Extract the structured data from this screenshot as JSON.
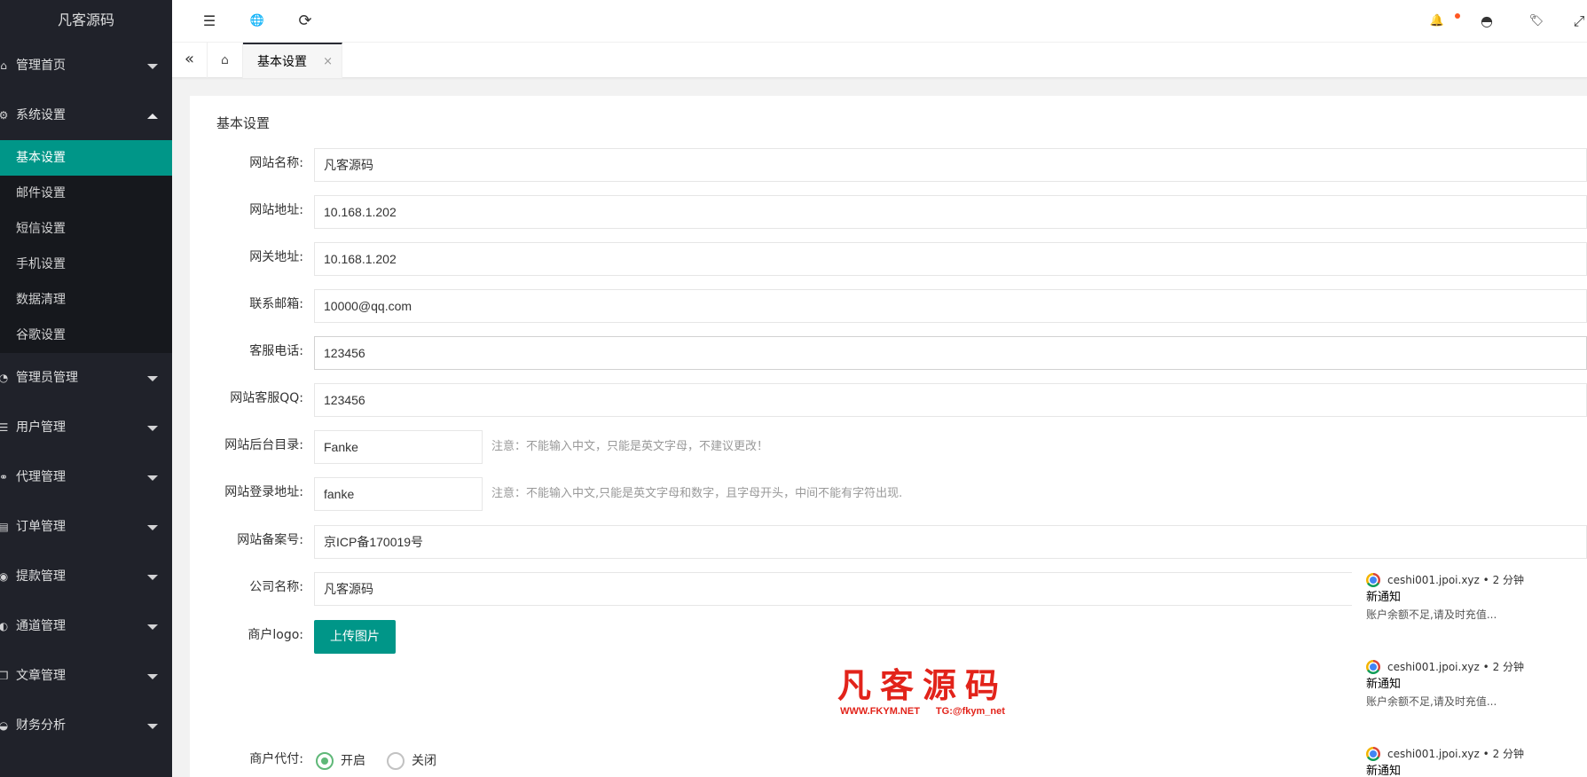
{
  "sidebar": {
    "logo": "凡客源码",
    "menus": [
      {
        "label": "管理首页",
        "icon": "⌂"
      },
      {
        "label": "系统设置",
        "icon": "⚙"
      },
      {
        "label": "管理员管理",
        "icon": "◔"
      },
      {
        "label": "用户管理",
        "icon": "☰"
      },
      {
        "label": "代理管理",
        "icon": "⚭"
      },
      {
        "label": "订单管理",
        "icon": "▤"
      },
      {
        "label": "提款管理",
        "icon": "◉"
      },
      {
        "label": "通道管理",
        "icon": "◐"
      },
      {
        "label": "文章管理",
        "icon": "❐"
      },
      {
        "label": "财务分析",
        "icon": "◒"
      }
    ],
    "submenu": [
      "基本设置",
      "邮件设置",
      "短信设置",
      "手机设置",
      "数据清理",
      "谷歌设置"
    ]
  },
  "header": {
    "icons": {
      "menu": "☰",
      "globe": "🌐",
      "refresh": "⟳",
      "bell": "🔔",
      "theme": "◓",
      "tag": "🏷",
      "expand": "⤢"
    },
    "notify_dot_color": "#ff5722"
  },
  "tabs": {
    "prev": "«",
    "home": "⌂",
    "active_label": "基本设置",
    "close": "×"
  },
  "form": {
    "title": "基本设置",
    "fields": [
      {
        "label": "网站名称:",
        "value": "凡客源码"
      },
      {
        "label": "网站地址:",
        "value": "10.168.1.202"
      },
      {
        "label": "网关地址:",
        "value": "10.168.1.202"
      },
      {
        "label": "联系邮箱:",
        "value": "10000@qq.com"
      },
      {
        "label": "客服电话:",
        "value": "123456"
      },
      {
        "label": "网站客服QQ:",
        "value": "123456"
      },
      {
        "label": "网站后台目录:",
        "value": "Fanke",
        "hint": "注意：不能输入中文，只能是英文字母，不建议更改！"
      },
      {
        "label": "网站登录地址:",
        "value": "fanke",
        "hint": "注意：不能输入中文,只能是英文字母和数字，且字母开头，中间不能有字符出现."
      },
      {
        "label": "网站备案号:",
        "value": "京ICP备170019号"
      },
      {
        "label": "公司名称:",
        "value": "凡客源码"
      }
    ],
    "logo_label": "商户logo:",
    "upload_button": "上传图片",
    "payout_label": "商户代付:",
    "payout_options": [
      "开启",
      "关闭"
    ],
    "payout_selected": "开启"
  },
  "watermark": {
    "main": "凡客源码",
    "site": "WWW.FKYM.NET",
    "tg": "TG:@fkym_net"
  },
  "notifications": [
    {
      "source": "ceshi001.jpoi.xyz",
      "time": "2 分钟",
      "title": "新通知",
      "body": "账户余额不足,请及时充值..."
    },
    {
      "source": "ceshi001.jpoi.xyz",
      "time": "2 分钟",
      "title": "新通知",
      "body": "账户余额不足,请及时充值..."
    },
    {
      "source": "ceshi001.jpoi.xyz",
      "time": "2 分钟",
      "title": "新通知",
      "body": ""
    }
  ],
  "colors": {
    "accent": "#009688",
    "sidebar_bg": "#20222a",
    "radio_checked": "#5fb878",
    "watermark": "#e2231a"
  }
}
